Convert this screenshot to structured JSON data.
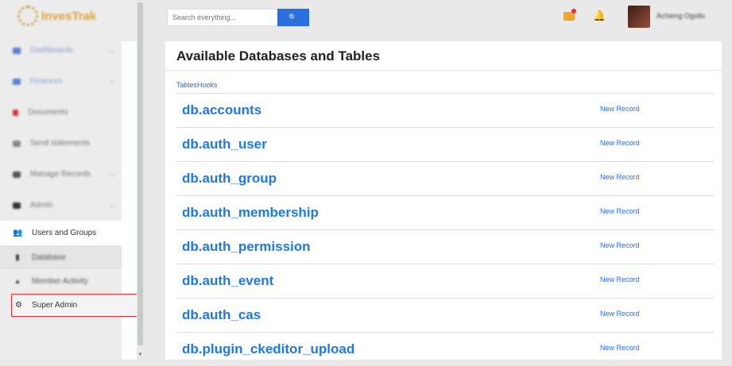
{
  "app": {
    "logo_text": "InvesTrak"
  },
  "header": {
    "search_placeholder": "Search everything...",
    "search_button": "🔍",
    "user_name": "Achieng Ogollo"
  },
  "sidebar": {
    "items": [
      {
        "label": "Dashboards",
        "icon": "dashboard-icon"
      },
      {
        "label": "Finances",
        "icon": "finance-icon"
      },
      {
        "label": "Documents",
        "icon": "document-icon"
      },
      {
        "label": "Send statements",
        "icon": "send-icon"
      },
      {
        "label": "Manage Records",
        "icon": "records-icon"
      },
      {
        "label": "Admin",
        "icon": "admin-icon"
      }
    ],
    "sub_items": [
      {
        "label": "Users and Groups",
        "icon": "users-icon"
      },
      {
        "label": "Database",
        "icon": "database-icon"
      },
      {
        "label": "Member Activity",
        "icon": "activity-icon"
      },
      {
        "label": "Super Admin",
        "icon": "gear-icon"
      }
    ]
  },
  "main": {
    "title": "Available Databases and Tables",
    "tables_hooks": "TablesHooks",
    "tables": [
      {
        "name": "db.accounts",
        "action": "New Record"
      },
      {
        "name": "db.auth_user",
        "action": "New Record"
      },
      {
        "name": "db.auth_group",
        "action": "New Record"
      },
      {
        "name": "db.auth_membership",
        "action": "New Record"
      },
      {
        "name": "db.auth_permission",
        "action": "New Record"
      },
      {
        "name": "db.auth_event",
        "action": "New Record"
      },
      {
        "name": "db.auth_cas",
        "action": "New Record"
      },
      {
        "name": "db.plugin_ckeditor_upload",
        "action": "New Record"
      }
    ]
  },
  "colors": {
    "accent": "#2a6fe0",
    "link": "#1f7ae0",
    "highlight_border": "#e0313b"
  }
}
